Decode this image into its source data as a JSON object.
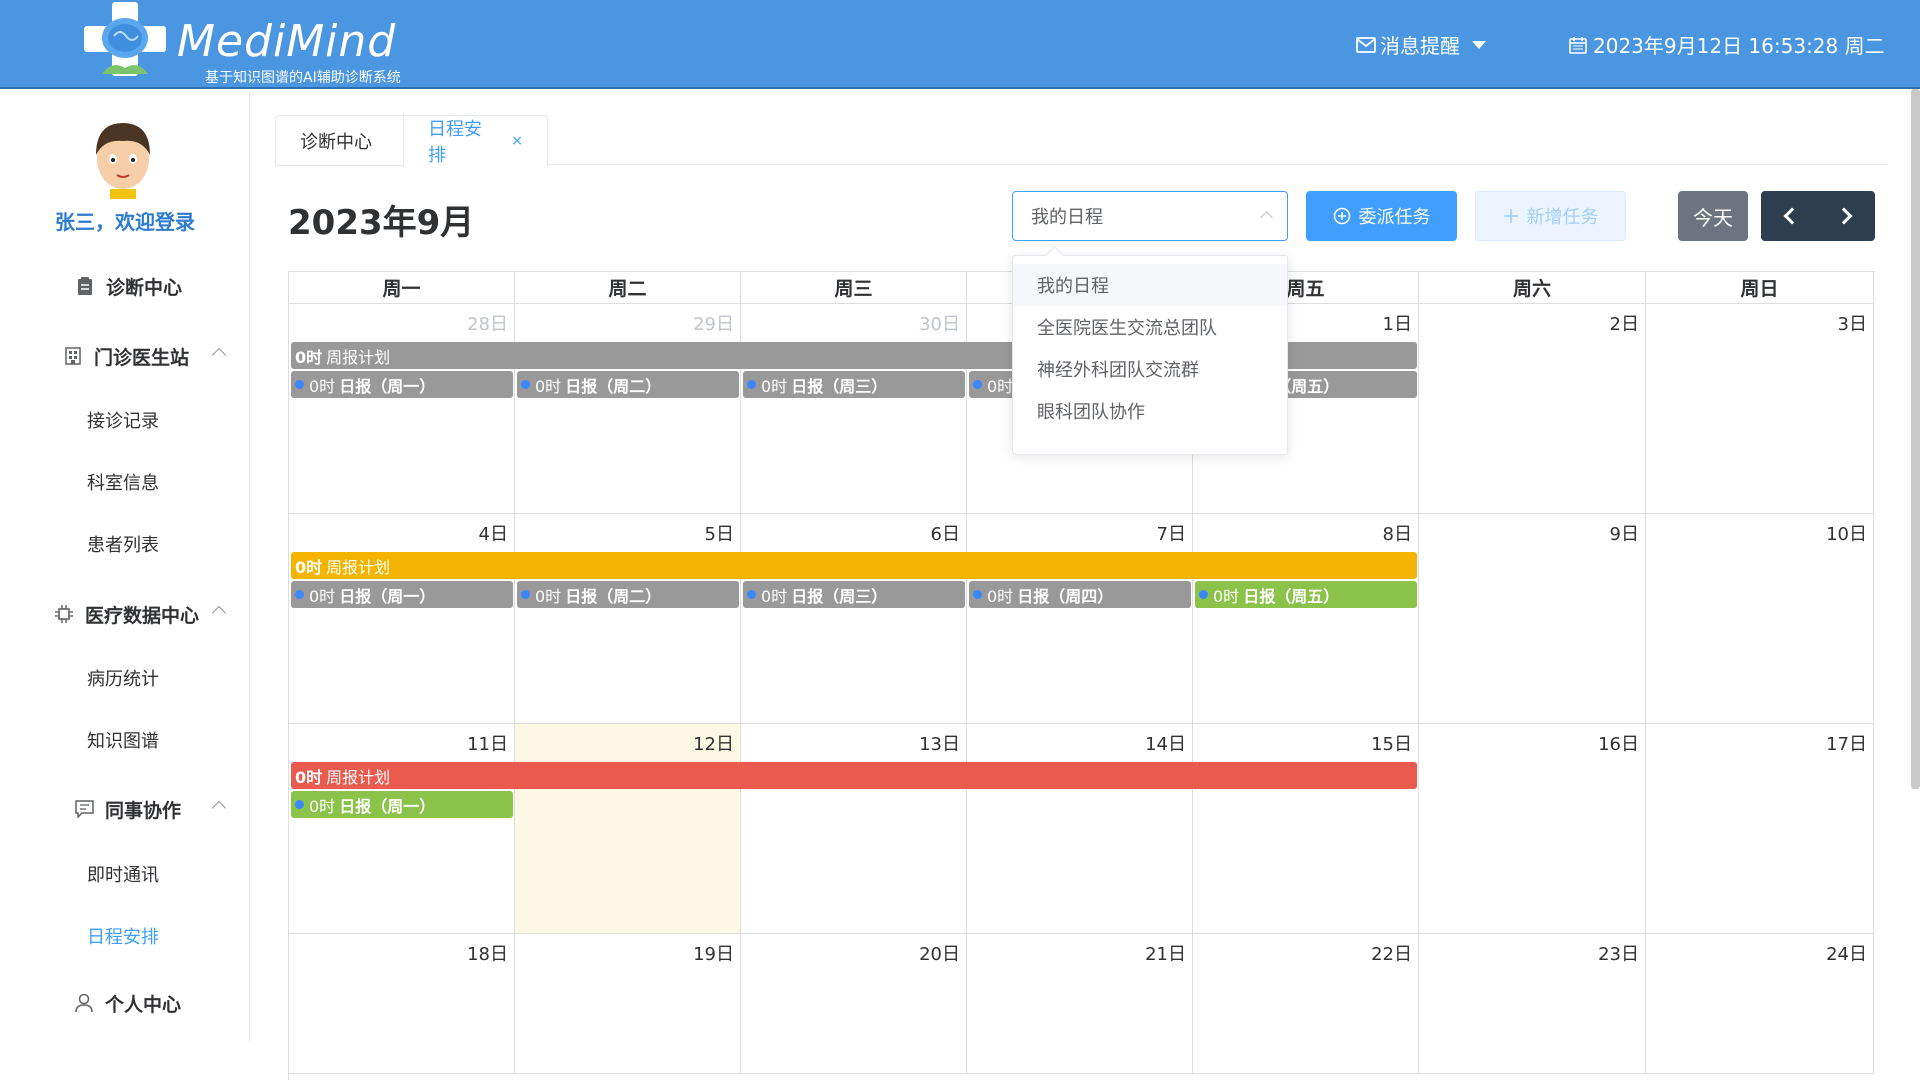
{
  "header": {
    "app_name": "MediMind",
    "subtitle": "基于知识图谱的AI辅助诊断系统",
    "message_label": "消息提醒",
    "datetime": "2023年9月12日 16:53:28 周二"
  },
  "sidebar": {
    "welcome": "张三，欢迎登录",
    "menu": {
      "diagnosis_center": "诊断中心",
      "outpatient_station": "门诊医生站",
      "visit_records": "接诊记录",
      "dept_info": "科室信息",
      "patient_list": "患者列表",
      "medical_data_center": "医疗数据中心",
      "record_stats": "病历统计",
      "knowledge_graph": "知识图谱",
      "colleague_collab": "同事协作",
      "instant_messaging": "即时通讯",
      "schedule": "日程安排",
      "personal_center": "个人中心"
    }
  },
  "tabs": [
    {
      "label": "诊断中心"
    },
    {
      "label": "日程安排",
      "close": "×"
    }
  ],
  "toolbar": {
    "month_title": "2023年9月",
    "select_value": "我的日程",
    "assign_label": "委派任务",
    "new_label": "新增任务",
    "today_label": "今天"
  },
  "dropdown": {
    "options": [
      "我的日程",
      "全医院医生交流总团队",
      "神经外科团队交流群",
      "眼科团队协作"
    ]
  },
  "calendar": {
    "weekdays": [
      "周一",
      "周二",
      "周三",
      "周四",
      "周五",
      "周六",
      "周日"
    ],
    "weeks": [
      {
        "days": [
          "28日",
          "29日",
          "30日",
          "31日",
          "1日",
          "2日",
          "3日"
        ],
        "other": [
          true,
          true,
          true,
          true,
          false,
          false,
          false
        ]
      },
      {
        "days": [
          "4日",
          "5日",
          "6日",
          "7日",
          "8日",
          "9日",
          "10日"
        ],
        "other": [
          false,
          false,
          false,
          false,
          false,
          false,
          false
        ]
      },
      {
        "days": [
          "11日",
          "12日",
          "13日",
          "14日",
          "15日",
          "16日",
          "17日"
        ],
        "other": [
          false,
          false,
          false,
          false,
          false,
          false,
          false
        ]
      },
      {
        "days": [
          "18日",
          "19日",
          "20日",
          "21日",
          "22日",
          "23日",
          "24日"
        ],
        "other": [
          false,
          false,
          false,
          false,
          false,
          false,
          false
        ]
      }
    ],
    "today_label": "12日",
    "weekly_events": [
      {
        "time": "0时",
        "title": "周报计划",
        "color": "#999999"
      },
      {
        "time": "0时",
        "title": "周报计划",
        "color": "#f4b400"
      },
      {
        "time": "0时",
        "title": "周报计划",
        "color": "#ea5a4f"
      }
    ],
    "daily_events": [
      [
        {
          "time": "0时",
          "title": "日报（周一）",
          "color": "#999999"
        },
        {
          "time": "0时",
          "title": "日报（周二）",
          "color": "#999999"
        },
        {
          "time": "0时",
          "title": "日报（周三）",
          "color": "#999999"
        },
        {
          "time": "0时",
          "title": "日报（周四）",
          "color": "#999999"
        },
        {
          "time": "0时",
          "title": "日报（周五）",
          "color": "#999999"
        }
      ],
      [
        {
          "time": "0时",
          "title": "日报（周一）",
          "color": "#999999"
        },
        {
          "time": "0时",
          "title": "日报（周二）",
          "color": "#999999"
        },
        {
          "time": "0时",
          "title": "日报（周三）",
          "color": "#999999"
        },
        {
          "time": "0时",
          "title": "日报（周四）",
          "color": "#999999"
        },
        {
          "time": "0时",
          "title": "日报（周五）",
          "color": "#8bc34a"
        }
      ],
      [
        {
          "time": "0时",
          "title": "日报（周一）",
          "color": "#8bc34a"
        }
      ]
    ]
  }
}
